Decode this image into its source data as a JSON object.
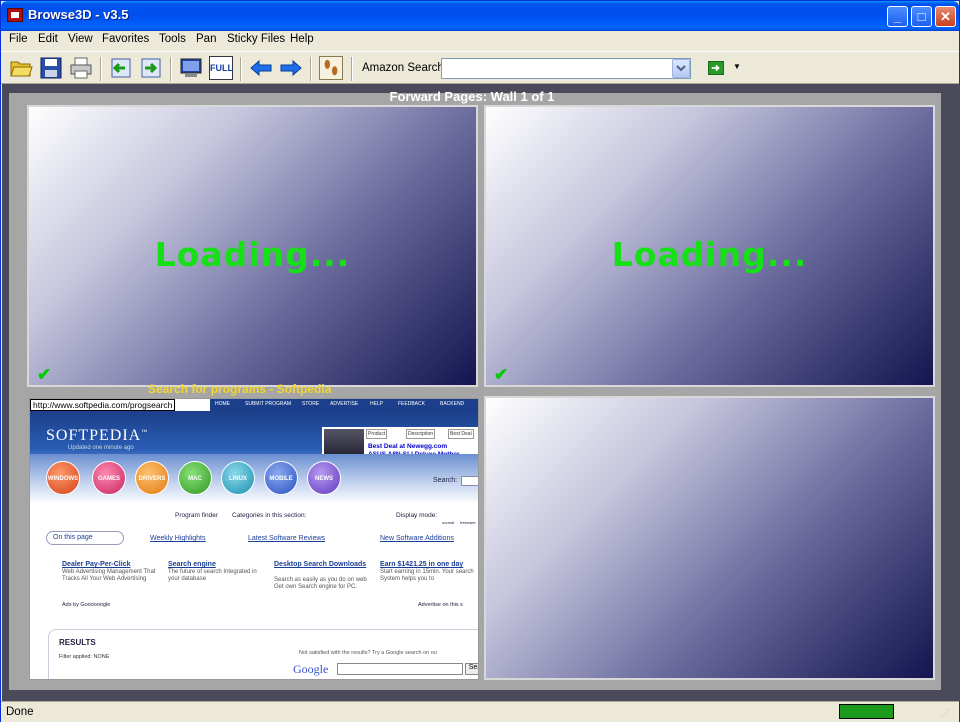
{
  "window": {
    "title": "Browse3D - v3.5"
  },
  "menu": [
    "File",
    "Edit",
    "View",
    "Favorites",
    "Tools",
    "Pan",
    "Sticky Files",
    "Help"
  ],
  "toolbar": {
    "amazon_label": "Amazon Search",
    "amazon_value": "",
    "full_label": "FULL",
    "icons": [
      "open-folder-icon",
      "save-icon",
      "print-icon",
      "import-icon",
      "export-icon",
      "monitor-icon",
      "full-screen-icon",
      "back-arrow-icon",
      "forward-arrow-icon",
      "footprints-icon",
      "go-icon"
    ]
  },
  "wall": {
    "title": "Forward Pages: Wall 1 of 1",
    "loading_text": "Loading...",
    "loaded_caption": "Search for programs - Softpedia",
    "loaded_url": "http://www.softpedia.com/progsearch"
  },
  "softpedia": {
    "logo": "SOFTPEDIA",
    "logo_mark": "™",
    "updated": "Updated one minute ago",
    "nav": [
      "HOME",
      "SUBMIT PROGRAM",
      "STORE",
      "ADVERTISE",
      "HELP",
      "FEEDBACK",
      "BACKEND"
    ],
    "ad_tabs": [
      "Product",
      "Description",
      "Best Deal"
    ],
    "ad_line1": "Best Deal at Newegg.com",
    "ad_line2": "ASUS A8N-SLI Deluxe Mother",
    "categories": [
      "WINDOWS",
      "GAMES",
      "DRIVERS",
      "MAC",
      "LINUX",
      "MOBILE",
      "NEWS"
    ],
    "search_label": "Search:",
    "program_finder": "Program finder",
    "categories_label": "Categories in this section:",
    "display_mode": "Display mode:",
    "display_opts": [
      "normal",
      "freeware"
    ],
    "on_this_page": "On this page",
    "weekly": "Weekly Highlights",
    "latest": "Latest Software Reviews",
    "new_adds": "New Software Additions",
    "ads": [
      {
        "title": "Dealer Pay-Per-Click",
        "desc": "Web Advertising Management That Tracks All Your Web Advertising"
      },
      {
        "title": "Search engine",
        "desc": "The future of search Integrated in your database"
      },
      {
        "title": "Desktop Search Downloads",
        "desc": "Search as easily as you do on web Get own Search engine for PC."
      },
      {
        "title": "Earn $1421.25 in one day",
        "desc": "Start earning in 15min. Your search System helps you to"
      }
    ],
    "ads_by": "Ads by Goooooogle",
    "advertise_on": "Advertise on this s",
    "results_title": "RESULTS",
    "filter": "Filter applied: NONE",
    "not_satisfied": "Not satisfied with the results? Try a Google search on ou",
    "google": "Google",
    "google_btn": "Sea"
  },
  "status": {
    "text": "Done",
    "indicator_color": "#1c9a1c"
  }
}
